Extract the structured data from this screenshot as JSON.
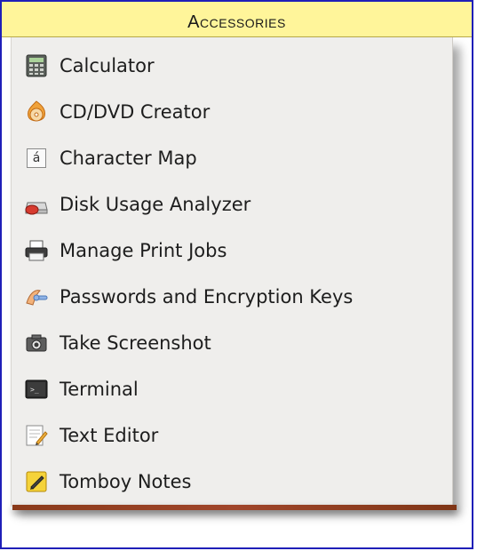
{
  "menu": {
    "title": "Accessories",
    "items": [
      {
        "label": "Calculator",
        "icon": "calculator-icon"
      },
      {
        "label": "CD/DVD Creator",
        "icon": "cd-dvd-creator-icon"
      },
      {
        "label": "Character Map",
        "icon": "character-map-icon",
        "icon_text": "á"
      },
      {
        "label": "Disk Usage Analyzer",
        "icon": "disk-usage-analyzer-icon"
      },
      {
        "label": "Manage Print Jobs",
        "icon": "printer-icon"
      },
      {
        "label": "Passwords and Encryption Keys",
        "icon": "passwords-keys-icon"
      },
      {
        "label": "Take Screenshot",
        "icon": "camera-icon"
      },
      {
        "label": "Terminal",
        "icon": "terminal-icon"
      },
      {
        "label": "Text Editor",
        "icon": "text-editor-icon"
      },
      {
        "label": "Tomboy Notes",
        "icon": "tomboy-notes-icon"
      }
    ]
  },
  "colors": {
    "header_bg": "#fff59a",
    "frame_border": "#1f1fb8",
    "menu_bg": "#efeeec",
    "bottom_bar": "#8a3a1a"
  }
}
